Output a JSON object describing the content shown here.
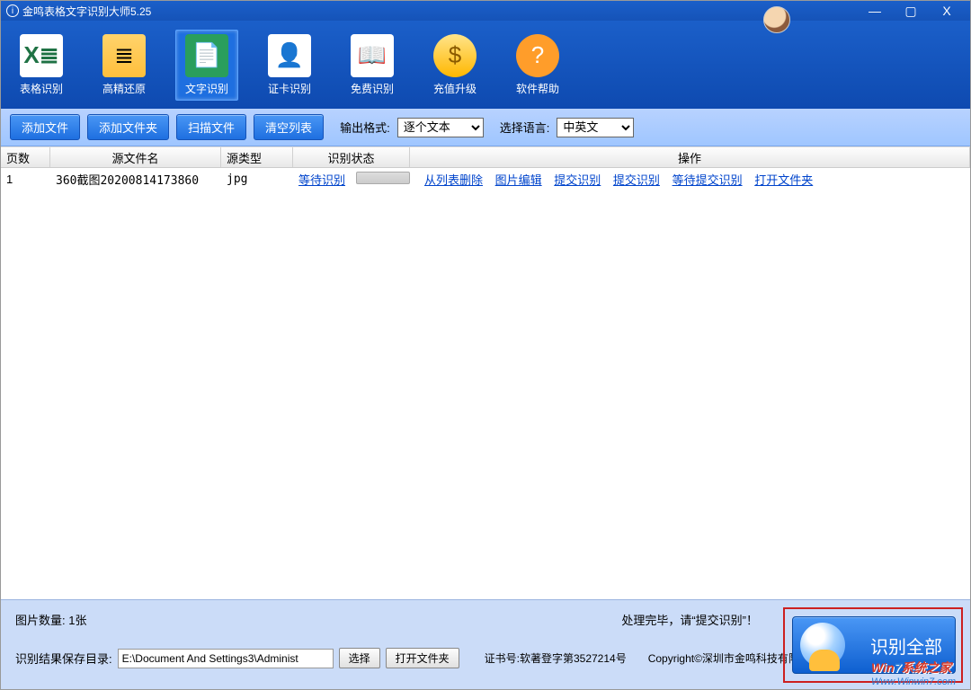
{
  "window": {
    "title": "金鸣表格文字识别大师5.25"
  },
  "winControls": {
    "min": "—",
    "max": "▢",
    "close": "X"
  },
  "toolbar": [
    {
      "id": "table-ocr",
      "label": "表格识别",
      "glyph": "X≣"
    },
    {
      "id": "high-precision",
      "label": "高精还原",
      "glyph": "≣"
    },
    {
      "id": "text-ocr",
      "label": "文字识别",
      "glyph": "📄",
      "active": true
    },
    {
      "id": "id-card",
      "label": "证卡识别",
      "glyph": "👤"
    },
    {
      "id": "free-ocr",
      "label": "免费识别",
      "glyph": "📖"
    },
    {
      "id": "recharge",
      "label": "充值升级",
      "glyph": "$"
    },
    {
      "id": "help",
      "label": "软件帮助",
      "glyph": "?"
    }
  ],
  "actionbar": {
    "buttons": [
      "添加文件",
      "添加文件夹",
      "扫描文件",
      "清空列表"
    ],
    "outLabel": "输出格式:",
    "outSelect": "逐个文本",
    "langLabel": "选择语言:",
    "langSelect": "中英文"
  },
  "table": {
    "headers": {
      "page": "页数",
      "file": "源文件名",
      "type": "源类型",
      "status": "识别状态",
      "ops": "操作"
    },
    "row": {
      "page": "1",
      "file": "360截图20200814173860",
      "type": "jpg",
      "status": "等待识别",
      "ops": [
        "从列表删除",
        "图片编辑",
        "提交识别",
        "提交识别",
        "等待提交识别",
        "打开文件夹"
      ]
    }
  },
  "footer": {
    "count": "图片数量: 1张",
    "done": "处理完毕，请“提交识别”！",
    "saveLabel": "识别结果保存目录:",
    "path": "E:\\Document And Settings3\\Administ",
    "choose": "选择",
    "open": "打开文件夹",
    "cert": "证书号:软著登字第3527214号",
    "copy": "Copyright©深圳市金鸣科技有限公司",
    "bigBtn": "识别全部"
  },
  "watermark": {
    "line1a": "Win",
    "line1b": "7",
    "line1c": "系统之家",
    "line2": "Www.Winwin7.com"
  }
}
